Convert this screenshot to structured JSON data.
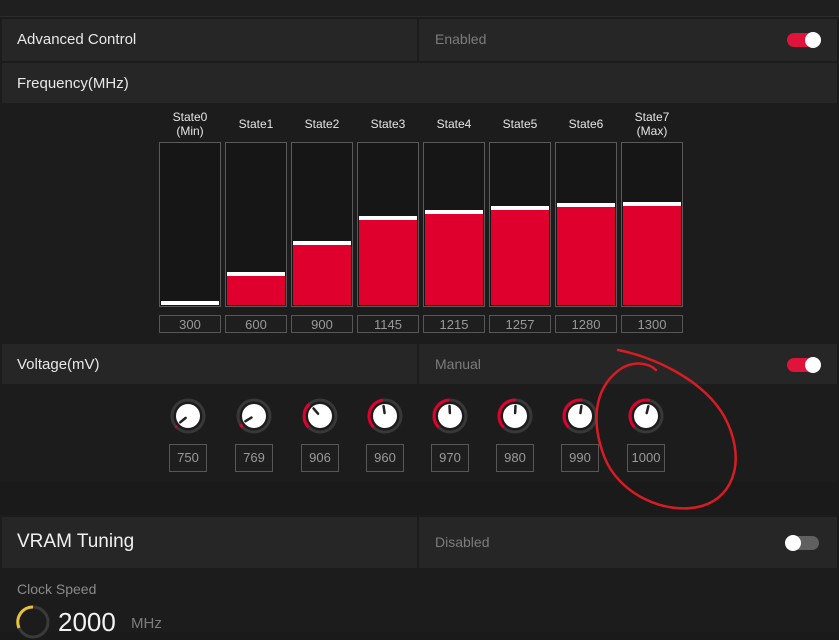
{
  "advanced_control": {
    "title": "Advanced Control",
    "status": "Enabled",
    "toggle_on": true
  },
  "frequency": {
    "title": "Frequency(MHz)",
    "states": [
      {
        "line1": "State0",
        "line2": "(Min)",
        "value": "300",
        "level": 0.0
      },
      {
        "line1": "State1",
        "line2": "",
        "value": "600",
        "level": 0.18
      },
      {
        "line1": "State2",
        "line2": "",
        "value": "900",
        "level": 0.37
      },
      {
        "line1": "State3",
        "line2": "",
        "value": "1145",
        "level": 0.52
      },
      {
        "line1": "State4",
        "line2": "",
        "value": "1215",
        "level": 0.56
      },
      {
        "line1": "State5",
        "line2": "",
        "value": "1257",
        "level": 0.58
      },
      {
        "line1": "State6",
        "line2": "",
        "value": "1280",
        "level": 0.6
      },
      {
        "line1": "State7",
        "line2": "(Max)",
        "value": "1300",
        "level": 0.61
      }
    ]
  },
  "voltage": {
    "title": "Voltage(mV)",
    "mode": "Manual",
    "toggle_on": true,
    "values": [
      "750",
      "769",
      "906",
      "960",
      "970",
      "980",
      "990",
      "1000"
    ],
    "levels": [
      0.0,
      0.05,
      0.35,
      0.47,
      0.49,
      0.51,
      0.53,
      0.55
    ]
  },
  "vram": {
    "title": "VRAM Tuning",
    "status": "Disabled",
    "toggle_on": false
  },
  "clock": {
    "label": "Clock Speed",
    "value": "2000",
    "unit": "MHz"
  },
  "colors": {
    "accent": "#e0002e",
    "annotation": "#d81c24"
  }
}
